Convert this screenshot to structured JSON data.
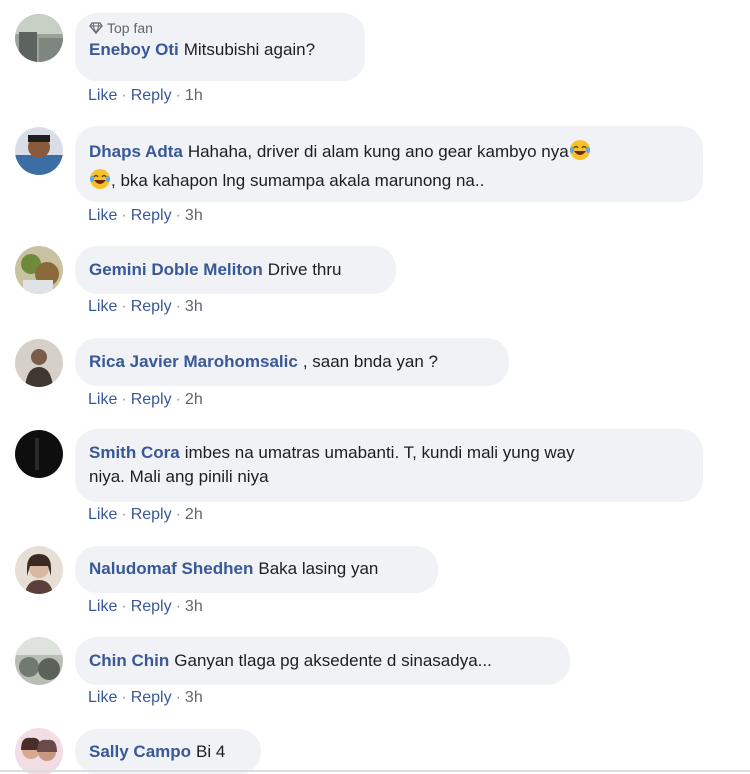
{
  "comments": [
    {
      "badge": "Top fan",
      "author": "Eneboy Oti",
      "text": "Mitsubishi again?",
      "like": "Like",
      "reply": "Reply",
      "time": "1h",
      "avatar_colors": [
        "#6e7470",
        "#a9b7a0"
      ]
    },
    {
      "author": "Dhaps Adta",
      "text_line1": "Hahaha, driver di alam kung ano gear kambyo nya",
      "text_line2": ", bka kahapon lng sumampa akala marunong na..",
      "emoji": "laughing-tears-emoji",
      "like": "Like",
      "reply": "Reply",
      "time": "3h",
      "avatar_colors": [
        "#3b6ea5",
        "#222b33"
      ]
    },
    {
      "author": "Gemini Doble Meliton",
      "text": "Drive thru",
      "like": "Like",
      "reply": "Reply",
      "time": "3h",
      "avatar_colors": [
        "#6d8b3b",
        "#c9c2a0"
      ]
    },
    {
      "author": "Rica Javier Marohomsalic",
      "text": ", saan bnda yan ?",
      "like": "Like",
      "reply": "Reply",
      "time": "2h",
      "avatar_colors": [
        "#a08872",
        "#403830"
      ]
    },
    {
      "author": "Smith Cora",
      "text_line1": "imbes na umatras umabanti. T, kundi mali yung way",
      "text_line2": "niya. Mali ang pinili niya",
      "like": "Like",
      "reply": "Reply",
      "time": "2h",
      "avatar_colors": [
        "#111111",
        "#2a2a2a"
      ]
    },
    {
      "author": "Naludomaf Shedhen",
      "text": "Baka lasing yan",
      "like": "Like",
      "reply": "Reply",
      "time": "3h",
      "avatar_colors": [
        "#d9c6b8",
        "#5a4038"
      ]
    },
    {
      "author": "Chin Chin",
      "text": "Ganyan tlaga pg aksedente d sinasadya...",
      "like": "Like",
      "reply": "Reply",
      "time": "3h",
      "avatar_colors": [
        "#707a70",
        "#b8beb4"
      ]
    },
    {
      "author": "Sally Campo",
      "text": "Bi 4",
      "avatar_colors": [
        "#e8b9c6",
        "#6b4a4a"
      ]
    }
  ],
  "separator": "·",
  "colors": {
    "author": "#385898",
    "bubble": "#f0f2f5",
    "meta": "#606770"
  }
}
